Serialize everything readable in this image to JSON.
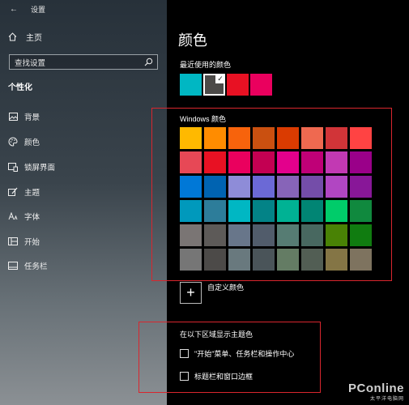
{
  "window": {
    "title": "设置"
  },
  "sidebar": {
    "home_label": "主页",
    "search_placeholder": "查找设置",
    "section_title": "个性化",
    "items": [
      {
        "label": "背景",
        "icon": "image-icon"
      },
      {
        "label": "颜色",
        "icon": "palette-icon"
      },
      {
        "label": "锁屏界面",
        "icon": "lock-screen-icon"
      },
      {
        "label": "主题",
        "icon": "theme-brush-icon"
      },
      {
        "label": "字体",
        "icon": "font-icon"
      },
      {
        "label": "开始",
        "icon": "start-grid-icon"
      },
      {
        "label": "任务栏",
        "icon": "taskbar-icon"
      }
    ]
  },
  "main": {
    "title": "颜色",
    "recent_label": "最近使用的颜色",
    "recent_colors": [
      "#00b7c3",
      "#4c4a48",
      "#e81123",
      "#ea005e"
    ],
    "recent_selected_index": 1,
    "windows_colors_label": "Windows 颜色",
    "windows_colors": [
      [
        "#ffb900",
        "#ff8c00",
        "#f7630c",
        "#ca5010",
        "#da3b01",
        "#ef6950",
        "#d13438",
        "#ff4343"
      ],
      [
        "#e74856",
        "#e81123",
        "#ea005e",
        "#c30052",
        "#e3008c",
        "#bf0077",
        "#c239b3",
        "#9a0089"
      ],
      [
        "#0078d7",
        "#0063b1",
        "#8e8cd8",
        "#6b69d6",
        "#8764b8",
        "#744da9",
        "#b146c2",
        "#881798"
      ],
      [
        "#0099bc",
        "#2d7d9a",
        "#00b7c3",
        "#038387",
        "#00b294",
        "#018574",
        "#00cc6a",
        "#10893e"
      ],
      [
        "#7a7574",
        "#5d5a58",
        "#68768a",
        "#515c6b",
        "#567c73",
        "#486860",
        "#498205",
        "#107c10"
      ],
      [
        "#767676",
        "#4c4a48",
        "#69797e",
        "#4a5459",
        "#647c64",
        "#525e54",
        "#847545",
        "#7e735f"
      ]
    ],
    "custom_color_label": "自定义颜色",
    "custom_color_symbol": "+",
    "show_accent_label": "在以下区域显示主题色",
    "checkboxes": [
      {
        "label": "\"开始\"菜单、任务栏和操作中心",
        "checked": false
      },
      {
        "label": "标题栏和窗口边框",
        "checked": false
      }
    ]
  },
  "watermark": {
    "brand": "PConline",
    "sub": "太平洋电脑网"
  },
  "accent": {
    "annotation_red": "#d9262e"
  }
}
